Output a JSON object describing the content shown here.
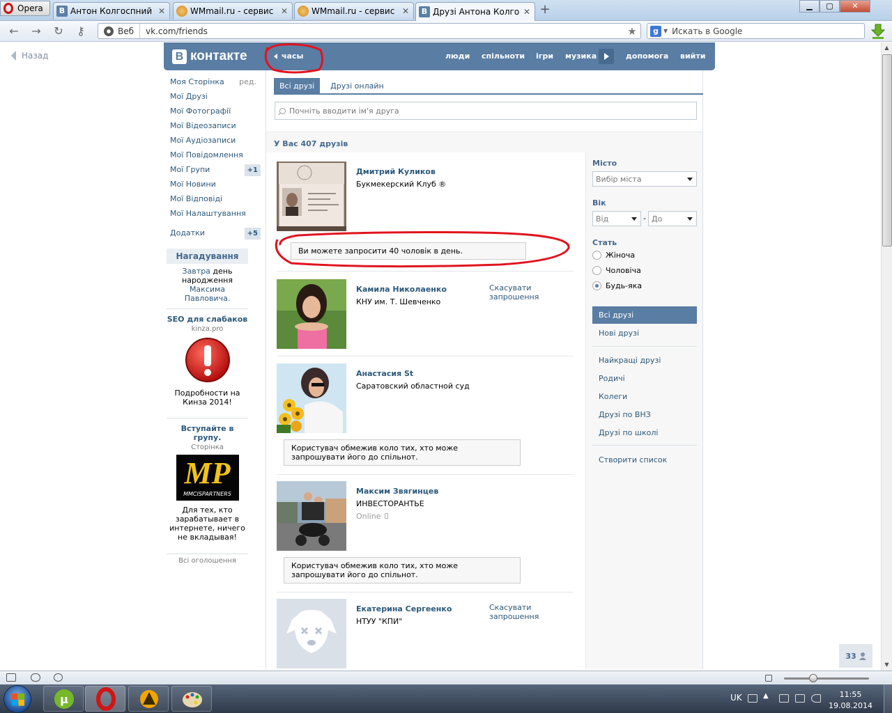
{
  "browser": {
    "menu_label": "Opera",
    "tabs": [
      {
        "title": "Антон Колгоспний",
        "icon": "vk-favicon"
      },
      {
        "title": "WMmail.ru - сервис п...",
        "icon": "wmmail-favicon"
      },
      {
        "title": "WMmail.ru - сервис п...",
        "icon": "wmmail-favicon"
      },
      {
        "title": "Друзі Антона Колгосп...",
        "icon": "vk-favicon",
        "active": true
      }
    ],
    "address_mode": "Веб",
    "url": "vk.com/friends",
    "search_placeholder": "Искать в Google"
  },
  "page": {
    "back_label": "Назад"
  },
  "vk_header": {
    "logo_text": "контакте",
    "logo_letter": "В",
    "status": "часы",
    "menu": [
      "люди",
      "спільноти",
      "ігри",
      "музика",
      "допомога",
      "вийти"
    ]
  },
  "left_nav": {
    "items": [
      {
        "label": "Моя Сторінка",
        "extra": "ред."
      },
      {
        "label": "Мої Друзі"
      },
      {
        "label": "Мої Фотографії"
      },
      {
        "label": "Мої Відеозаписи"
      },
      {
        "label": "Мої Аудіозаписи"
      },
      {
        "label": "Мої Повідомлення"
      },
      {
        "label": "Мої Групи",
        "badge": "+1"
      },
      {
        "label": "Мої Новини"
      },
      {
        "label": "Мої Відповіді"
      },
      {
        "label": "Мої Налаштування"
      }
    ],
    "apps": {
      "label": "Додатки",
      "badge": "+5"
    },
    "reminder": {
      "title": "Нагадування",
      "line1_link": "Завтра",
      "line1_text": " день народження",
      "line2_link": "Максима Павловича."
    },
    "ads": [
      {
        "title": "SEO для слабаков",
        "sub": "kinza.pro",
        "text": "Подробности на Кинза 2014!"
      },
      {
        "title": "Вступайте в групу.",
        "sub": "Сторінка",
        "logo": "MP",
        "logo_sub": "MMCISPARTNERS",
        "text": "Для тех, кто зарабатывает в интернете, ничего не вкладывая!"
      }
    ],
    "all_ads": "Всі оголошення"
  },
  "friends": {
    "tabs": [
      "Всі друзі",
      "Друзі онлайн"
    ],
    "search_placeholder": "Почніть вводити ім'я друга",
    "count_text": "У Вас 407 друзів",
    "list": [
      {
        "name": "Дмитрий Куликов",
        "sub": "Букмекерский Клуб ®",
        "action": "",
        "online": ""
      },
      {
        "name": "Камила Николаенко",
        "sub": "КНУ им. Т. Шевченко",
        "action": "Скасувати запрошення",
        "online": ""
      },
      {
        "name": "Анастасия St",
        "sub": "Саратовский областной суд",
        "action": "",
        "online": ""
      },
      {
        "name": "Максим Звягинцев",
        "sub": "ИНВЕСТОРАНТЬЕ",
        "action": "",
        "online": "Online"
      },
      {
        "name": "Екатерина Сергеенко",
        "sub": "НТУУ \"КПИ\"",
        "action": "Скасувати запрошення",
        "online": ""
      }
    ],
    "notice_invite": "Ви можете запросити 40 чоловік в день.",
    "notice_restricted": "Користувач обмежив коло тих, хто може запрошувати його до спільнот."
  },
  "filter": {
    "city_label": "Місто",
    "city_placeholder": "Вибір міста",
    "age_label": "Вік",
    "age_from": "Від",
    "age_dash": "-",
    "age_to": "До",
    "sex_label": "Стать",
    "sex_options": [
      "Жіноча",
      "Чоловіча",
      "Будь-яка"
    ],
    "sex_selected_index": 2,
    "lists_active": "Всі друзі",
    "lists": [
      "Нові друзі",
      "Найкращі друзі",
      "Родичі",
      "Колеги",
      "Друзі по ВНЗ",
      "Друзі по школі"
    ],
    "create_list": "Створити список"
  },
  "corner_counter": "33",
  "taskbar": {
    "lang": "UK",
    "time": "11:55",
    "date": "19.08.2014"
  },
  "colors": {
    "vk_blue": "#597da3",
    "link": "#2b587a",
    "annotation_red": "#e0141e"
  }
}
